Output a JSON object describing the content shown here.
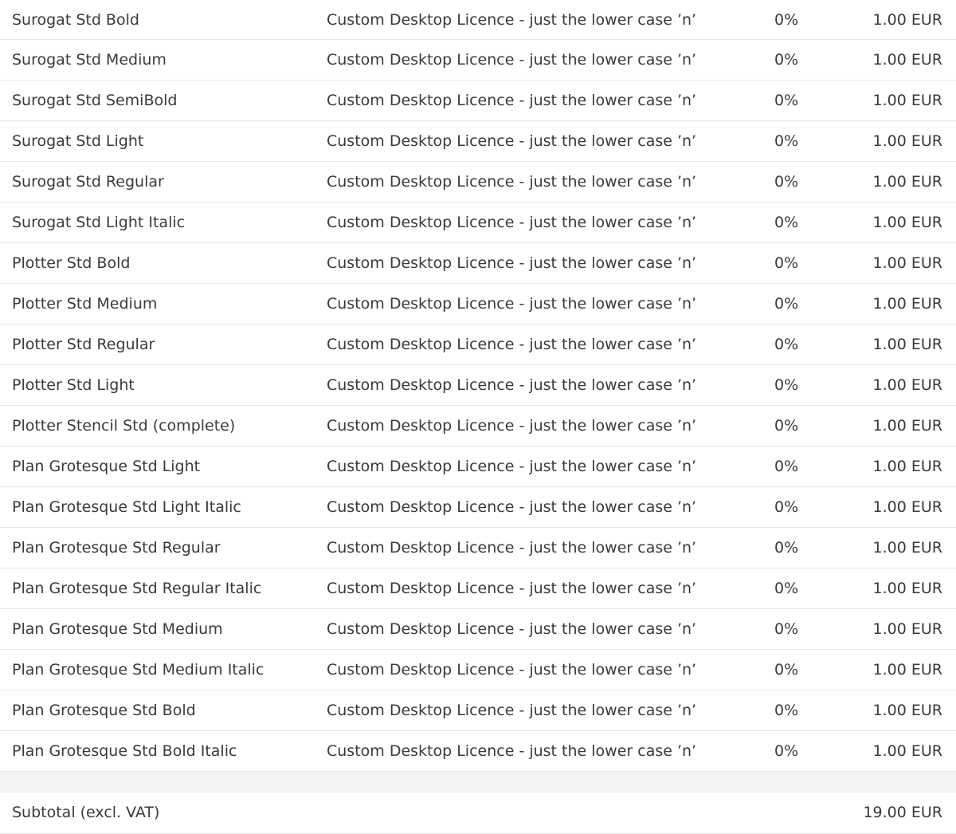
{
  "items": [
    {
      "name": "Surogat Std Bold",
      "licence": "Custom Desktop Licence - just the lower case ’n’",
      "vat": "0%",
      "price": "1.00 EUR"
    },
    {
      "name": "Surogat Std Medium",
      "licence": "Custom Desktop Licence - just the lower case ’n’",
      "vat": "0%",
      "price": "1.00 EUR"
    },
    {
      "name": "Surogat Std SemiBold",
      "licence": "Custom Desktop Licence - just the lower case ’n’",
      "vat": "0%",
      "price": "1.00 EUR"
    },
    {
      "name": "Surogat Std Light",
      "licence": "Custom Desktop Licence - just the lower case ’n’",
      "vat": "0%",
      "price": "1.00 EUR"
    },
    {
      "name": "Surogat Std Regular",
      "licence": "Custom Desktop Licence - just the lower case ’n’",
      "vat": "0%",
      "price": "1.00 EUR"
    },
    {
      "name": "Surogat Std Light Italic",
      "licence": "Custom Desktop Licence - just the lower case ’n’",
      "vat": "0%",
      "price": "1.00 EUR"
    },
    {
      "name": "Plotter Std Bold",
      "licence": "Custom Desktop Licence - just the lower case ’n’",
      "vat": "0%",
      "price": "1.00 EUR"
    },
    {
      "name": "Plotter Std Medium",
      "licence": "Custom Desktop Licence - just the lower case ’n’",
      "vat": "0%",
      "price": "1.00 EUR"
    },
    {
      "name": "Plotter Std Regular",
      "licence": "Custom Desktop Licence - just the lower case ’n’",
      "vat": "0%",
      "price": "1.00 EUR"
    },
    {
      "name": "Plotter Std Light",
      "licence": "Custom Desktop Licence - just the lower case ’n’",
      "vat": "0%",
      "price": "1.00 EUR"
    },
    {
      "name": "Plotter Stencil Std (complete)",
      "licence": "Custom Desktop Licence - just the lower case ’n’",
      "vat": "0%",
      "price": "1.00 EUR"
    },
    {
      "name": "Plan Grotesque Std Light",
      "licence": "Custom Desktop Licence - just the lower case ’n’",
      "vat": "0%",
      "price": "1.00 EUR"
    },
    {
      "name": "Plan Grotesque Std Light Italic",
      "licence": "Custom Desktop Licence - just the lower case ’n’",
      "vat": "0%",
      "price": "1.00 EUR"
    },
    {
      "name": "Plan Grotesque Std Regular",
      "licence": "Custom Desktop Licence - just the lower case ’n’",
      "vat": "0%",
      "price": "1.00 EUR"
    },
    {
      "name": "Plan Grotesque Std Regular Italic",
      "licence": "Custom Desktop Licence - just the lower case ’n’",
      "vat": "0%",
      "price": "1.00 EUR"
    },
    {
      "name": "Plan Grotesque Std Medium",
      "licence": "Custom Desktop Licence - just the lower case ’n’",
      "vat": "0%",
      "price": "1.00 EUR"
    },
    {
      "name": "Plan Grotesque Std Medium Italic",
      "licence": "Custom Desktop Licence - just the lower case ’n’",
      "vat": "0%",
      "price": "1.00 EUR"
    },
    {
      "name": "Plan Grotesque Std Bold",
      "licence": "Custom Desktop Licence - just the lower case ’n’",
      "vat": "0%",
      "price": "1.00 EUR"
    },
    {
      "name": "Plan Grotesque Std Bold Italic",
      "licence": "Custom Desktop Licence - just the lower case ’n’",
      "vat": "0%",
      "price": "1.00 EUR"
    }
  ],
  "subtotal": {
    "label": "Subtotal (excl. VAT)",
    "value": "19.00 EUR"
  },
  "colors": {
    "text": "#3a3a3a",
    "divider": "#e6e6e6",
    "spacer_bg": "#f4f4f4"
  }
}
